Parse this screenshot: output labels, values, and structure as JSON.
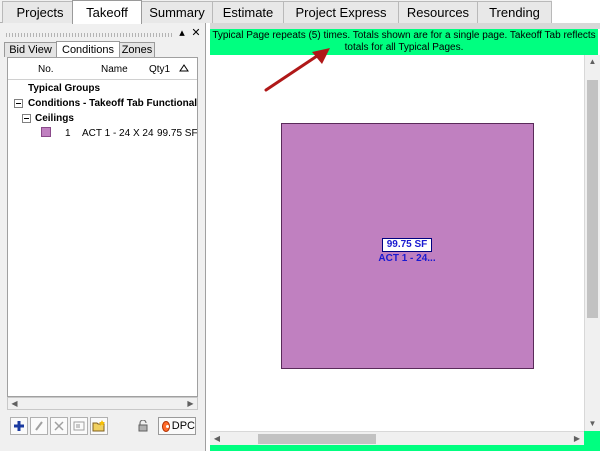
{
  "main_tabs": [
    {
      "label": "Projects",
      "active": false
    },
    {
      "label": "Takeoff",
      "active": true
    },
    {
      "label": "Summary",
      "active": false
    },
    {
      "label": "Estimate",
      "active": false
    },
    {
      "label": "Project Express",
      "active": false
    },
    {
      "label": "Resources",
      "active": false
    },
    {
      "label": "Trending",
      "active": false
    }
  ],
  "left_panel": {
    "sub_tabs": [
      {
        "label": "Bid View",
        "active": false
      },
      {
        "label": "Conditions",
        "active": true
      },
      {
        "label": "Zones",
        "active": false
      }
    ],
    "grid": {
      "columns": {
        "no": "No.",
        "name": "Name",
        "qty": "Qty1"
      },
      "typical_groups": "Typical Groups",
      "group": "Conditions - Takeoff Tab Functionality",
      "subgroup": "Ceilings",
      "item": {
        "no": "1",
        "name": "ACT 1 - 24 X 24",
        "qty": "99.75 SF",
        "color": "#c080c0"
      }
    },
    "toolbar": {
      "icons": [
        "add-icon",
        "edit-icon",
        "delete-icon",
        "copy-icon",
        "new-folder-icon",
        "lock-icon"
      ],
      "dpc_label": "DPC"
    }
  },
  "canvas": {
    "banner": "Typical Page repeats (5) times. Totals shown are for a single page. Takeoff Tab reflects totals for all Typical Pages.",
    "banner_color": "#00ff80",
    "region": {
      "qty": "99.75 SF",
      "name": "ACT 1 - 24...",
      "fill": "#c080c0"
    }
  }
}
